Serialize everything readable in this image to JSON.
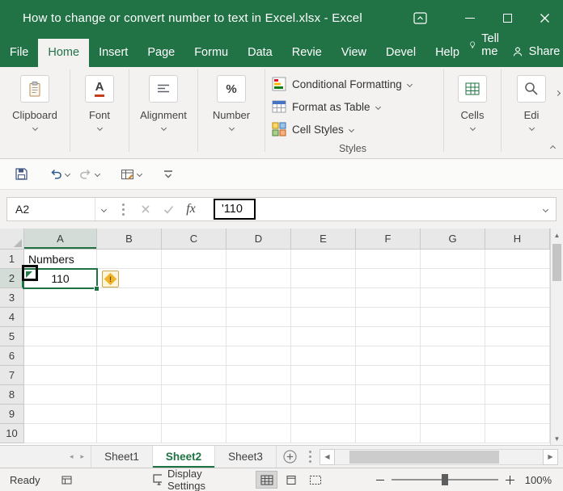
{
  "window": {
    "title": "How to change or convert number to text in Excel.xlsx  -  Excel"
  },
  "tabs": {
    "items": [
      "File",
      "Home",
      "Insert",
      "Page",
      "Formu",
      "Data",
      "Revie",
      "View",
      "Devel",
      "Help"
    ],
    "tell_me": "Tell me",
    "share": "Share"
  },
  "ribbon": {
    "clipboard": "Clipboard",
    "font": "Font",
    "alignment": "Alignment",
    "number": "Number",
    "conditional_formatting": "Conditional Formatting",
    "format_as_table": "Format as Table",
    "cell_styles": "Cell Styles",
    "styles_label": "Styles",
    "cells": "Cells",
    "editing": "Edi"
  },
  "formula_bar": {
    "name_box": "A2",
    "fx": "fx",
    "value": "'110"
  },
  "grid": {
    "columns": [
      "A",
      "B",
      "C",
      "D",
      "E",
      "F",
      "G",
      "H"
    ],
    "rows": [
      "1",
      "2",
      "3",
      "4",
      "5",
      "6",
      "7",
      "8",
      "9",
      "10"
    ],
    "cells": {
      "A1": "Numbers",
      "A2": "110"
    },
    "selected": {
      "col": "A",
      "row": "2"
    }
  },
  "sheets": {
    "items": [
      "Sheet1",
      "Sheet2",
      "Sheet3"
    ],
    "active": "Sheet2"
  },
  "status": {
    "ready": "Ready",
    "display_settings": "Display Settings",
    "zoom": "100%"
  },
  "colors": {
    "excel_green": "#217346",
    "warning_yellow": "#efb52a",
    "annotation_black": "#000000"
  }
}
